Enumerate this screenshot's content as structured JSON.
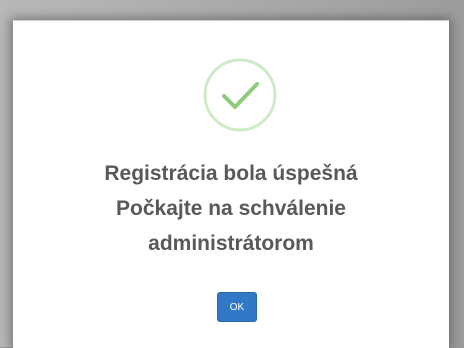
{
  "dialog": {
    "icon": "check-circle-icon",
    "accent_color": "#8ccc7a",
    "message_lines": [
      "Registrácia bola úspešná",
      "Počkajte na schválenie",
      "administrátorom"
    ],
    "ok_label": "OK",
    "ok_color": "#3179c7"
  }
}
